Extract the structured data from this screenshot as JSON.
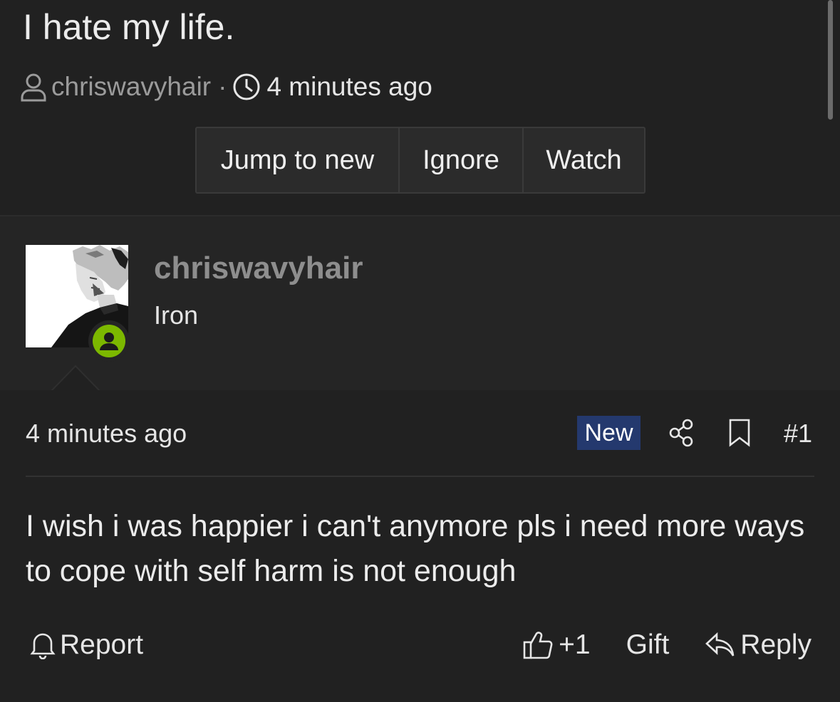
{
  "thread": {
    "title": "I hate my life.",
    "author": "chriswavyhair",
    "separator": "·",
    "time": "4 minutes ago",
    "actions": {
      "jump_to_new": "Jump to new",
      "ignore": "Ignore",
      "watch": "Watch"
    }
  },
  "post": {
    "user": {
      "name": "chriswavyhair",
      "title": "Iron",
      "status": "online",
      "status_color": "#7cb800"
    },
    "date": "4 minutes ago",
    "badge": "New",
    "badge_color": "#24396e",
    "number": "#1",
    "message": "I wish i was happier i can't anymore pls i need more ways to cope with self harm is not enough",
    "footer": {
      "report": "Report",
      "like": "+1",
      "gift": "Gift",
      "reply": "Reply"
    }
  },
  "icons": {
    "user": "user-icon",
    "clock": "clock-icon",
    "share": "share-icon",
    "bookmark": "bookmark-icon",
    "bell": "bell-icon",
    "thumbs_up": "thumbs-up-icon",
    "reply": "reply-icon"
  }
}
